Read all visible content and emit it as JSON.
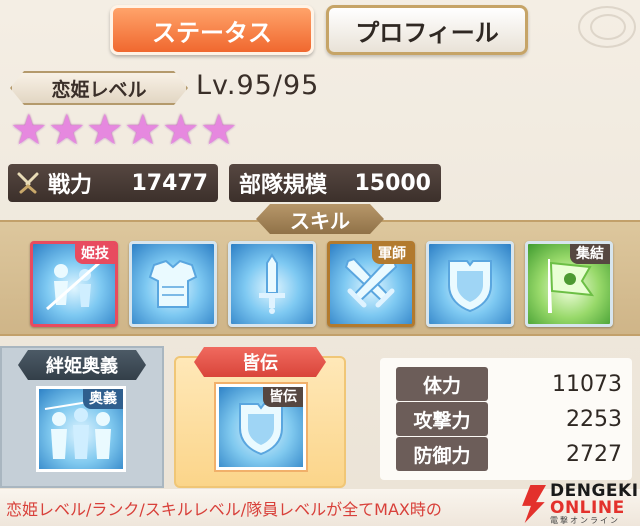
{
  "tabs": {
    "status": "ステータス",
    "profile": "プロフィール"
  },
  "level": {
    "label": "恋姫レベル",
    "value": "Lv.95/95"
  },
  "stars": {
    "count": 6,
    "glyph": "★",
    "color": "#e688df"
  },
  "power": {
    "icon": "crossed-swords-icon",
    "label": "戦力",
    "value": "17477"
  },
  "unit_size": {
    "label": "部隊規模",
    "value": "15000"
  },
  "skills": {
    "header": "スキル",
    "items": [
      {
        "icon": "warrior-figures-icon",
        "tag": "姫技"
      },
      {
        "icon": "armor-icon",
        "tag": ""
      },
      {
        "icon": "sword-icon",
        "tag": ""
      },
      {
        "icon": "crossed-swords-icon",
        "tag": "軍師"
      },
      {
        "icon": "shield-icon",
        "tag": ""
      },
      {
        "icon": "green-flag-icon",
        "tag": "集結"
      }
    ]
  },
  "kizuna": {
    "title": "絆姫奥義",
    "tag": "奥義",
    "icon": "warrior-silhouettes-icon"
  },
  "kaiden": {
    "title": "皆伝",
    "tag": "皆伝",
    "icon": "shield-icon"
  },
  "params": [
    {
      "label": "体力",
      "value": "11073"
    },
    {
      "label": "攻撃力",
      "value": "2253"
    },
    {
      "label": "防御力",
      "value": "2727"
    }
  ],
  "footer_text": "恋姫レベル/ランク/スキルレベル/隊員レベルが全てMAX時の",
  "watermark": {
    "line1": "DENGEKI",
    "line2": "ONLINE",
    "line3": "電撃オンライン"
  },
  "colors": {
    "accent_orange": "#f0682f",
    "star_pink": "#e688df",
    "footer_red": "#d8403a",
    "skill_blue": "#2d7fc5"
  }
}
